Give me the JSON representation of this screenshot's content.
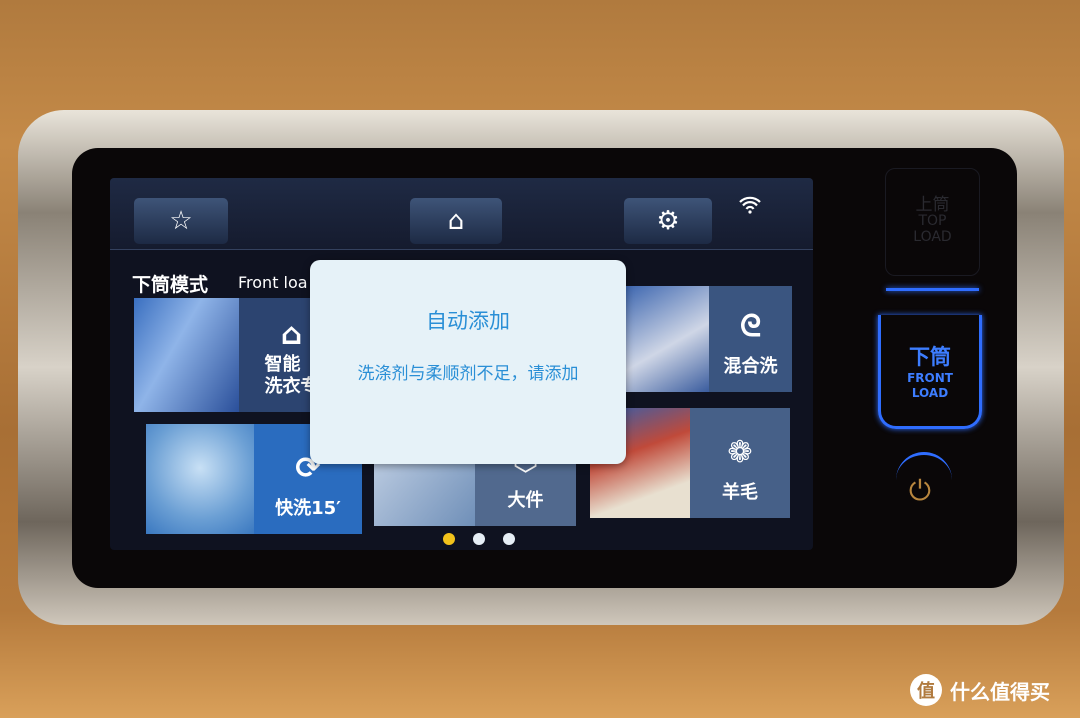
{
  "toolbar": {
    "favorite_icon": "☆",
    "home_icon": "⌂",
    "settings_icon": "⚙",
    "wifi_icon": "wifi"
  },
  "mode": {
    "title": "下筒模式",
    "subtitle": "Front loa"
  },
  "tiles": [
    {
      "label": "智能\n洗衣专",
      "icon": "graduation-cap",
      "glyph": "🎓"
    },
    {
      "label": "混合洗",
      "icon": "mixed-wash",
      "glyph": "ᘓ"
    },
    {
      "label": "快洗15′",
      "icon": "timer-15",
      "glyph": "⟳"
    },
    {
      "label": "大件",
      "icon": "bulky",
      "glyph": "⬡"
    },
    {
      "label": "羊毛",
      "icon": "wool",
      "glyph": "❁"
    }
  ],
  "pager": {
    "pages": 3,
    "current": 1
  },
  "dialog": {
    "title": "自动添加",
    "message": "洗涤剂与柔顺剂不足，请添加"
  },
  "side_panel": {
    "top_load_cn": "上筒",
    "top_load_en1": "TOP",
    "top_load_en2": "LOAD",
    "front_load_cn": "下筒",
    "front_load_en1": "FRONT",
    "front_load_en2": "LOAD",
    "power_icon": "⏻"
  },
  "watermark": {
    "logo": "值",
    "text": "什么值得买"
  },
  "colors": {
    "accent_blue": "#2f6dff",
    "dialog_text": "#2a8fd6",
    "active_dot": "#f2c21b"
  }
}
